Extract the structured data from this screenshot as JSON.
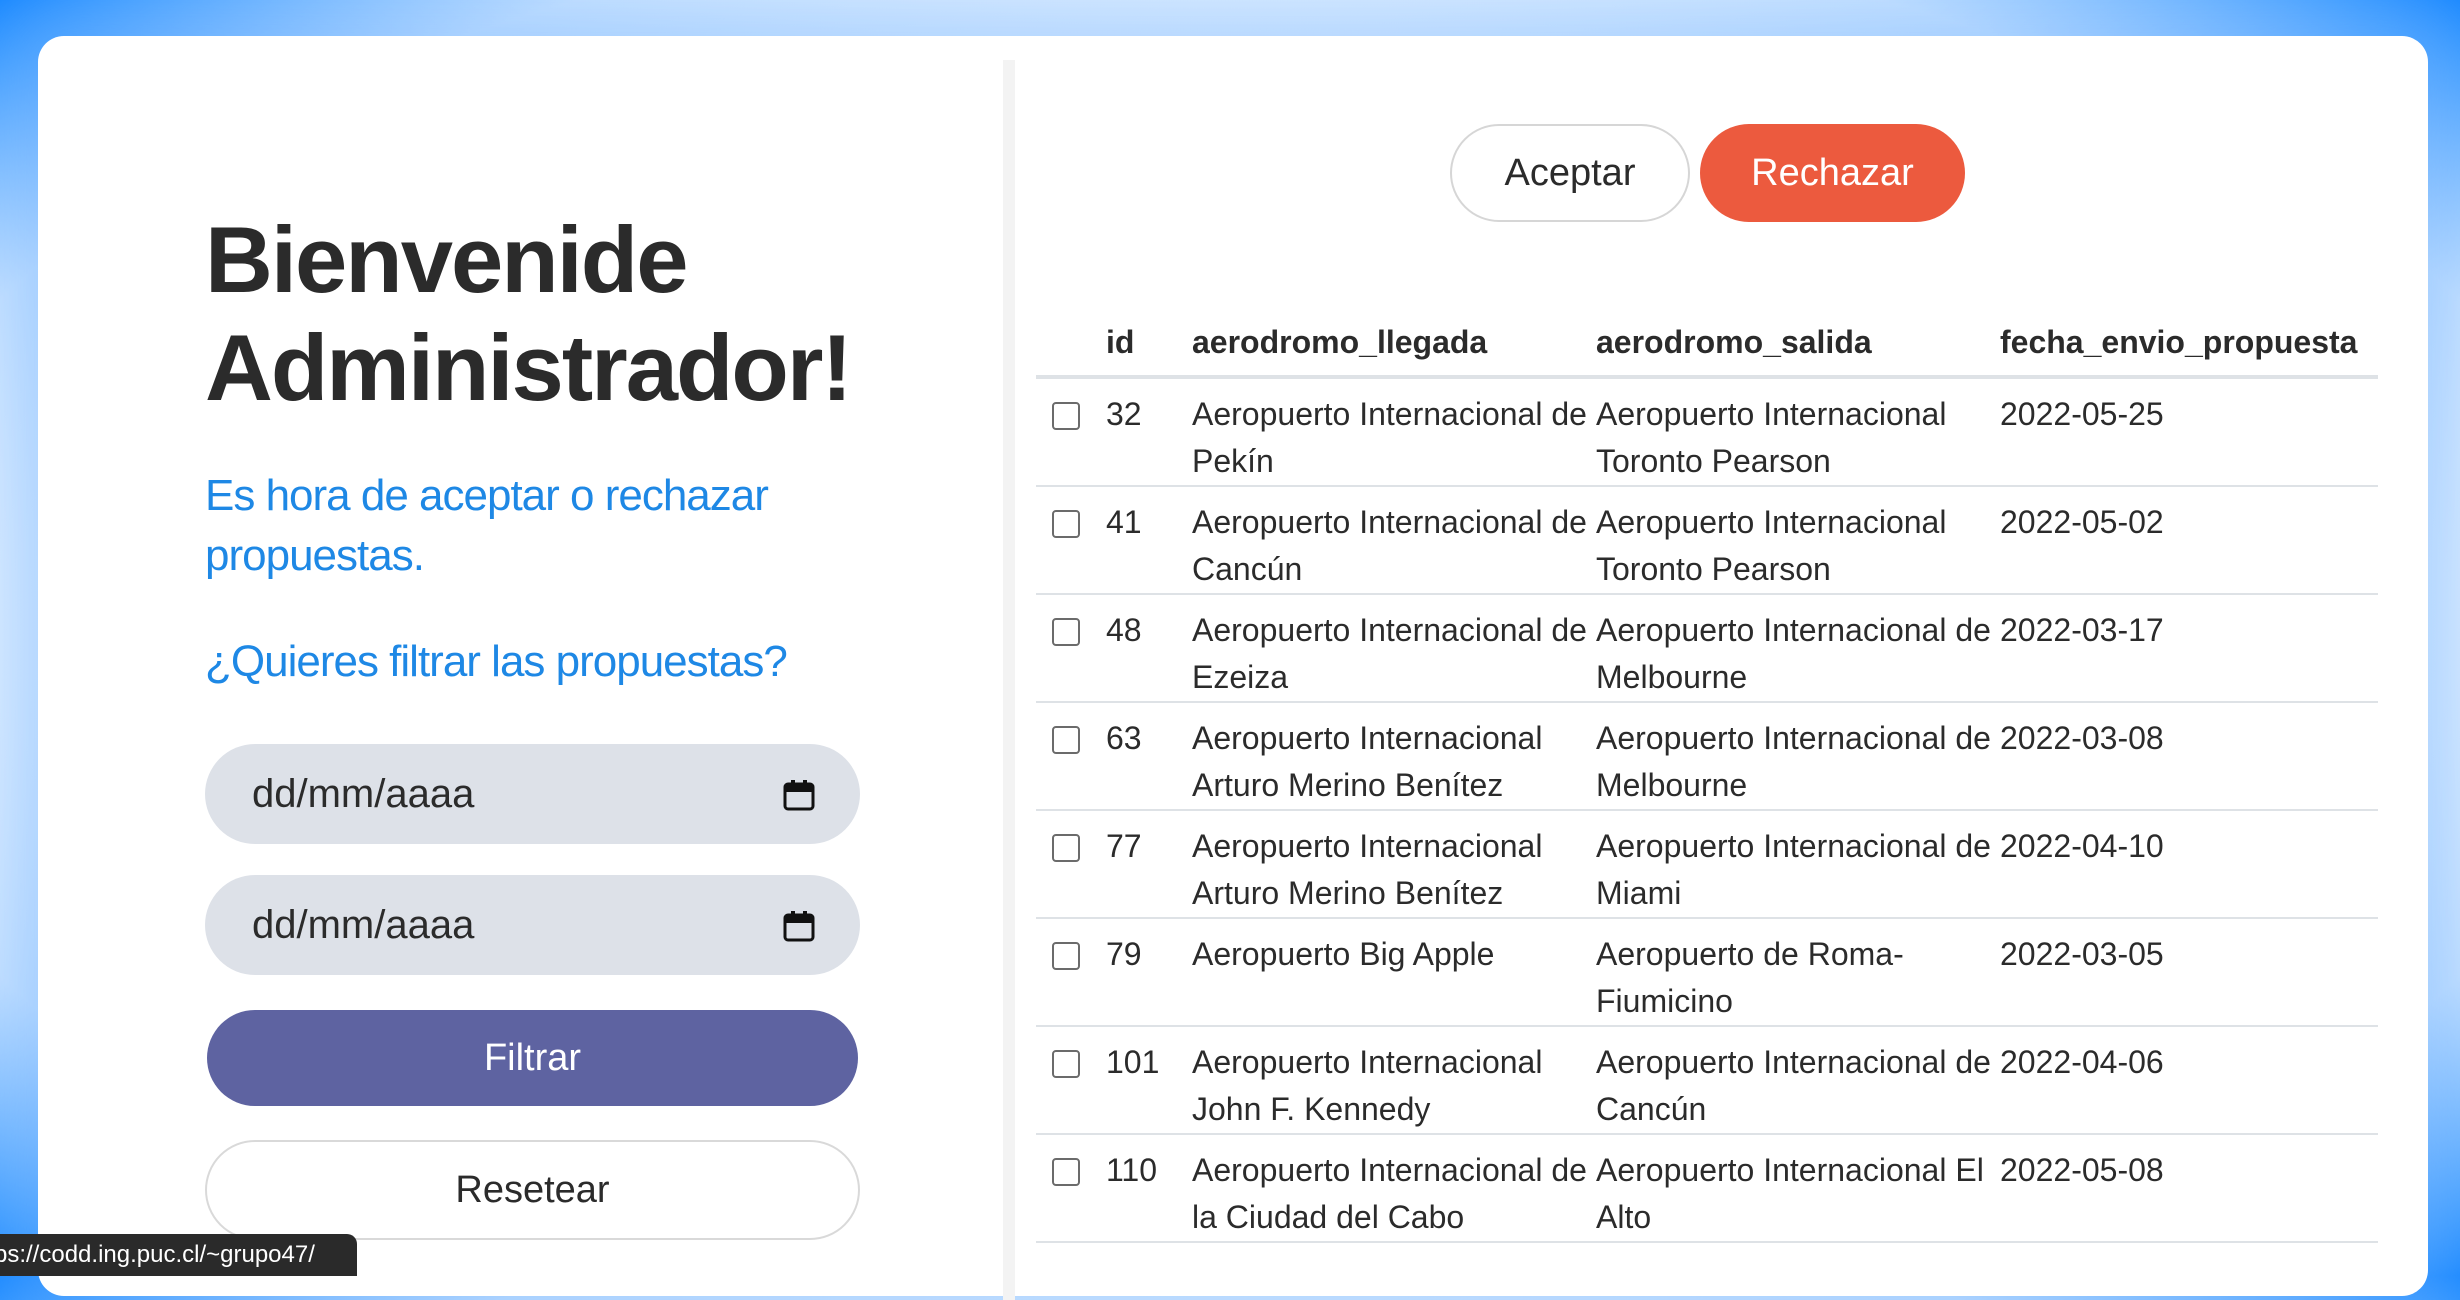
{
  "left": {
    "title": "Bienvenide Administrador!",
    "subtitle": "Es hora de aceptar o rechazar propuestas.",
    "filter_question": "¿Quieres filtrar las propuestas?",
    "date_from_placeholder": "dd/mm/aaaa",
    "date_to_placeholder": "dd/mm/aaaa",
    "filter_button": "Filtrar",
    "reset_button": "Resetear"
  },
  "actions": {
    "accept_button": "Aceptar",
    "reject_button": "Rechazar"
  },
  "table": {
    "headers": [
      "id",
      "aerodromo_llegada",
      "aerodromo_salida",
      "fecha_envio_propuesta"
    ],
    "rows": [
      {
        "id": "32",
        "llegada": "Aeropuerto Internacional de Pekín",
        "salida": "Aeropuerto Internacional Toronto Pearson",
        "fecha": "2022-05-25",
        "checked": false
      },
      {
        "id": "41",
        "llegada": "Aeropuerto Internacional de Cancún",
        "salida": "Aeropuerto Internacional Toronto Pearson",
        "fecha": "2022-05-02",
        "checked": false
      },
      {
        "id": "48",
        "llegada": "Aeropuerto Internacional de Ezeiza",
        "salida": "Aeropuerto Internacional de Melbourne",
        "fecha": "2022-03-17",
        "checked": false
      },
      {
        "id": "63",
        "llegada": "Aeropuerto Internacional Arturo Merino Benítez",
        "salida": "Aeropuerto Internacional de Melbourne",
        "fecha": "2022-03-08",
        "checked": false
      },
      {
        "id": "77",
        "llegada": "Aeropuerto Internacional Arturo Merino Benítez",
        "salida": "Aeropuerto Internacional de Miami",
        "fecha": "2022-04-10",
        "checked": false
      },
      {
        "id": "79",
        "llegada": "Aeropuerto Big Apple",
        "salida": "Aeropuerto de Roma-Fiumicino",
        "fecha": "2022-03-05",
        "checked": false
      },
      {
        "id": "101",
        "llegada": "Aeropuerto Internacional John F. Kennedy",
        "salida": "Aeropuerto Internacional de Cancún",
        "fecha": "2022-04-06",
        "checked": false
      },
      {
        "id": "110",
        "llegada": "Aeropuerto Internacional de la Ciudad del Cabo",
        "salida": "Aeropuerto Internacional El Alto",
        "fecha": "2022-05-08",
        "checked": false
      }
    ]
  },
  "status_bar": {
    "url": "ps://codd.ing.puc.cl/~grupo47/"
  },
  "colors": {
    "accent_blue": "#1e88e5",
    "filter_button": "#5e63a1",
    "reject_button": "#ec5a3e"
  }
}
